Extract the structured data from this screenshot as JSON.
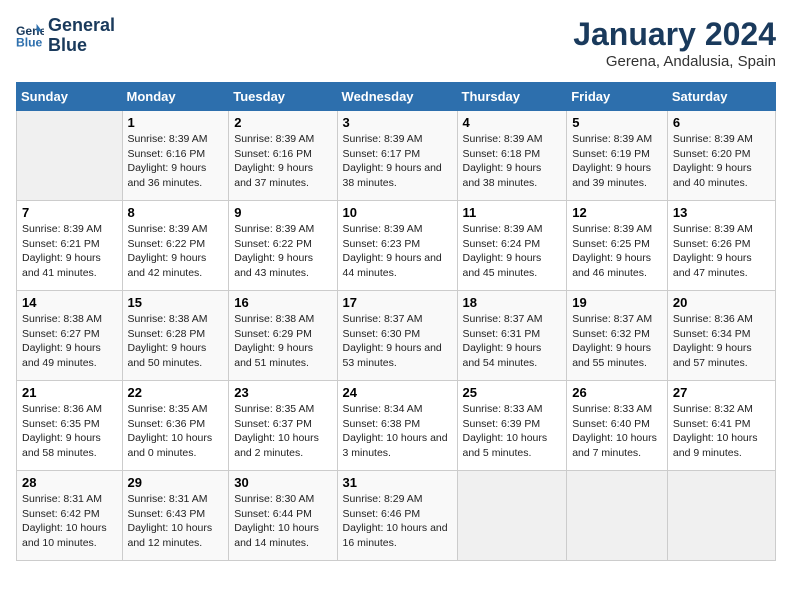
{
  "header": {
    "logo": {
      "line1": "General",
      "line2": "Blue"
    },
    "title": "January 2024",
    "location": "Gerena, Andalusia, Spain"
  },
  "weekdays": [
    "Sunday",
    "Monday",
    "Tuesday",
    "Wednesday",
    "Thursday",
    "Friday",
    "Saturday"
  ],
  "weeks": [
    [
      {
        "day": "",
        "empty": true
      },
      {
        "day": "1",
        "sunrise": "Sunrise: 8:39 AM",
        "sunset": "Sunset: 6:16 PM",
        "daylight": "Daylight: 9 hours and 36 minutes."
      },
      {
        "day": "2",
        "sunrise": "Sunrise: 8:39 AM",
        "sunset": "Sunset: 6:16 PM",
        "daylight": "Daylight: 9 hours and 37 minutes."
      },
      {
        "day": "3",
        "sunrise": "Sunrise: 8:39 AM",
        "sunset": "Sunset: 6:17 PM",
        "daylight": "Daylight: 9 hours and 38 minutes."
      },
      {
        "day": "4",
        "sunrise": "Sunrise: 8:39 AM",
        "sunset": "Sunset: 6:18 PM",
        "daylight": "Daylight: 9 hours and 38 minutes."
      },
      {
        "day": "5",
        "sunrise": "Sunrise: 8:39 AM",
        "sunset": "Sunset: 6:19 PM",
        "daylight": "Daylight: 9 hours and 39 minutes."
      },
      {
        "day": "6",
        "sunrise": "Sunrise: 8:39 AM",
        "sunset": "Sunset: 6:20 PM",
        "daylight": "Daylight: 9 hours and 40 minutes."
      }
    ],
    [
      {
        "day": "7",
        "sunrise": "Sunrise: 8:39 AM",
        "sunset": "Sunset: 6:21 PM",
        "daylight": "Daylight: 9 hours and 41 minutes."
      },
      {
        "day": "8",
        "sunrise": "Sunrise: 8:39 AM",
        "sunset": "Sunset: 6:22 PM",
        "daylight": "Daylight: 9 hours and 42 minutes."
      },
      {
        "day": "9",
        "sunrise": "Sunrise: 8:39 AM",
        "sunset": "Sunset: 6:22 PM",
        "daylight": "Daylight: 9 hours and 43 minutes."
      },
      {
        "day": "10",
        "sunrise": "Sunrise: 8:39 AM",
        "sunset": "Sunset: 6:23 PM",
        "daylight": "Daylight: 9 hours and 44 minutes."
      },
      {
        "day": "11",
        "sunrise": "Sunrise: 8:39 AM",
        "sunset": "Sunset: 6:24 PM",
        "daylight": "Daylight: 9 hours and 45 minutes."
      },
      {
        "day": "12",
        "sunrise": "Sunrise: 8:39 AM",
        "sunset": "Sunset: 6:25 PM",
        "daylight": "Daylight: 9 hours and 46 minutes."
      },
      {
        "day": "13",
        "sunrise": "Sunrise: 8:39 AM",
        "sunset": "Sunset: 6:26 PM",
        "daylight": "Daylight: 9 hours and 47 minutes."
      }
    ],
    [
      {
        "day": "14",
        "sunrise": "Sunrise: 8:38 AM",
        "sunset": "Sunset: 6:27 PM",
        "daylight": "Daylight: 9 hours and 49 minutes."
      },
      {
        "day": "15",
        "sunrise": "Sunrise: 8:38 AM",
        "sunset": "Sunset: 6:28 PM",
        "daylight": "Daylight: 9 hours and 50 minutes."
      },
      {
        "day": "16",
        "sunrise": "Sunrise: 8:38 AM",
        "sunset": "Sunset: 6:29 PM",
        "daylight": "Daylight: 9 hours and 51 minutes."
      },
      {
        "day": "17",
        "sunrise": "Sunrise: 8:37 AM",
        "sunset": "Sunset: 6:30 PM",
        "daylight": "Daylight: 9 hours and 53 minutes."
      },
      {
        "day": "18",
        "sunrise": "Sunrise: 8:37 AM",
        "sunset": "Sunset: 6:31 PM",
        "daylight": "Daylight: 9 hours and 54 minutes."
      },
      {
        "day": "19",
        "sunrise": "Sunrise: 8:37 AM",
        "sunset": "Sunset: 6:32 PM",
        "daylight": "Daylight: 9 hours and 55 minutes."
      },
      {
        "day": "20",
        "sunrise": "Sunrise: 8:36 AM",
        "sunset": "Sunset: 6:34 PM",
        "daylight": "Daylight: 9 hours and 57 minutes."
      }
    ],
    [
      {
        "day": "21",
        "sunrise": "Sunrise: 8:36 AM",
        "sunset": "Sunset: 6:35 PM",
        "daylight": "Daylight: 9 hours and 58 minutes."
      },
      {
        "day": "22",
        "sunrise": "Sunrise: 8:35 AM",
        "sunset": "Sunset: 6:36 PM",
        "daylight": "Daylight: 10 hours and 0 minutes."
      },
      {
        "day": "23",
        "sunrise": "Sunrise: 8:35 AM",
        "sunset": "Sunset: 6:37 PM",
        "daylight": "Daylight: 10 hours and 2 minutes."
      },
      {
        "day": "24",
        "sunrise": "Sunrise: 8:34 AM",
        "sunset": "Sunset: 6:38 PM",
        "daylight": "Daylight: 10 hours and 3 minutes."
      },
      {
        "day": "25",
        "sunrise": "Sunrise: 8:33 AM",
        "sunset": "Sunset: 6:39 PM",
        "daylight": "Daylight: 10 hours and 5 minutes."
      },
      {
        "day": "26",
        "sunrise": "Sunrise: 8:33 AM",
        "sunset": "Sunset: 6:40 PM",
        "daylight": "Daylight: 10 hours and 7 minutes."
      },
      {
        "day": "27",
        "sunrise": "Sunrise: 8:32 AM",
        "sunset": "Sunset: 6:41 PM",
        "daylight": "Daylight: 10 hours and 9 minutes."
      }
    ],
    [
      {
        "day": "28",
        "sunrise": "Sunrise: 8:31 AM",
        "sunset": "Sunset: 6:42 PM",
        "daylight": "Daylight: 10 hours and 10 minutes."
      },
      {
        "day": "29",
        "sunrise": "Sunrise: 8:31 AM",
        "sunset": "Sunset: 6:43 PM",
        "daylight": "Daylight: 10 hours and 12 minutes."
      },
      {
        "day": "30",
        "sunrise": "Sunrise: 8:30 AM",
        "sunset": "Sunset: 6:44 PM",
        "daylight": "Daylight: 10 hours and 14 minutes."
      },
      {
        "day": "31",
        "sunrise": "Sunrise: 8:29 AM",
        "sunset": "Sunset: 6:46 PM",
        "daylight": "Daylight: 10 hours and 16 minutes."
      },
      {
        "day": "",
        "empty": true
      },
      {
        "day": "",
        "empty": true
      },
      {
        "day": "",
        "empty": true
      }
    ]
  ]
}
